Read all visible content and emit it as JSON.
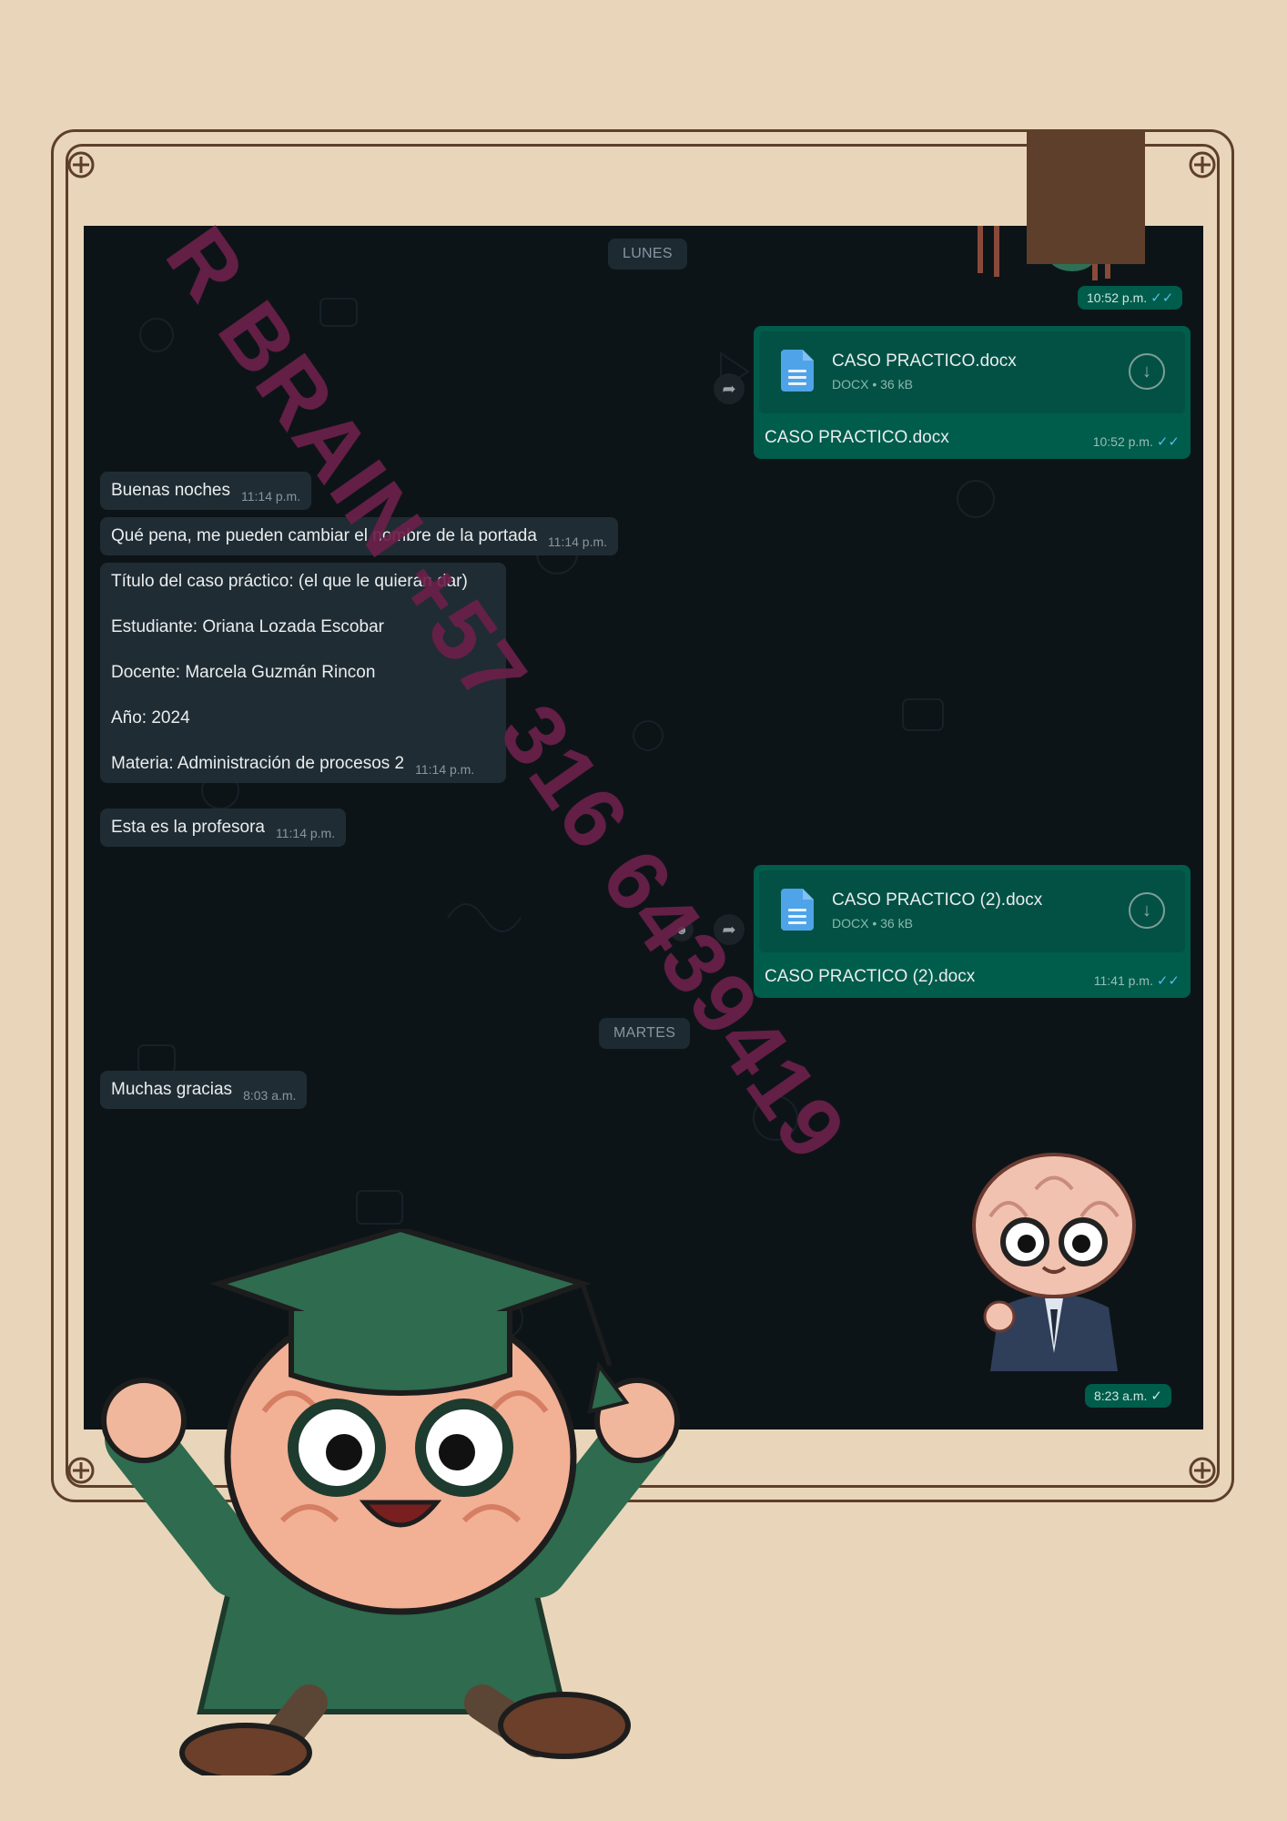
{
  "chat": {
    "day_labels": [
      "LUNES",
      "MARTES"
    ],
    "top_sent_time": "10:52 p.m.",
    "doc1": {
      "name": "CASO PRACTICO.docx",
      "meta": "DOCX • 36 kB",
      "caption": "CASO PRACTICO.docx",
      "time": "10:52 p.m."
    },
    "msgs": [
      {
        "text": "Buenas noches",
        "time": "11:14 p.m."
      },
      {
        "text": "Qué pena, me pueden cambiar el nombre de la portada",
        "time": "11:14 p.m."
      },
      {
        "lines": [
          "Título del caso práctico: (el que le quieran dar)",
          "Estudiante: Oriana Lozada Escobar",
          "Docente: Marcela Guzmán Rincon",
          "Año: 2024",
          "Materia: Administración de procesos 2"
        ],
        "time": "11:14 p.m."
      },
      {
        "text": "Esta es la profesora",
        "time": "11:14 p.m."
      },
      {
        "text": "Muchas gracias",
        "time": "8:03 a.m."
      }
    ],
    "doc2": {
      "name": "CASO PRACTICO (2).docx",
      "meta": "DOCX • 36 kB",
      "caption": "CASO PRACTICO (2).docx",
      "time": "11:41 p.m."
    },
    "last_sent_time": "8:23 a.m."
  },
  "watermark": "R BRAIN +57 316 6439419",
  "icons": {
    "file": "document-icon",
    "download": "download-icon",
    "forward": "forward-icon",
    "emoji": "emoji-icon",
    "read": "double-check-icon",
    "sent": "single-check-icon"
  },
  "colors": {
    "page_bg": "#e9d6ba",
    "frame": "#5e3f2b",
    "chat_bg": "#0d1418",
    "incoming": "#202c33",
    "outgoing": "#005c4b",
    "watermark": "#6b2049"
  }
}
